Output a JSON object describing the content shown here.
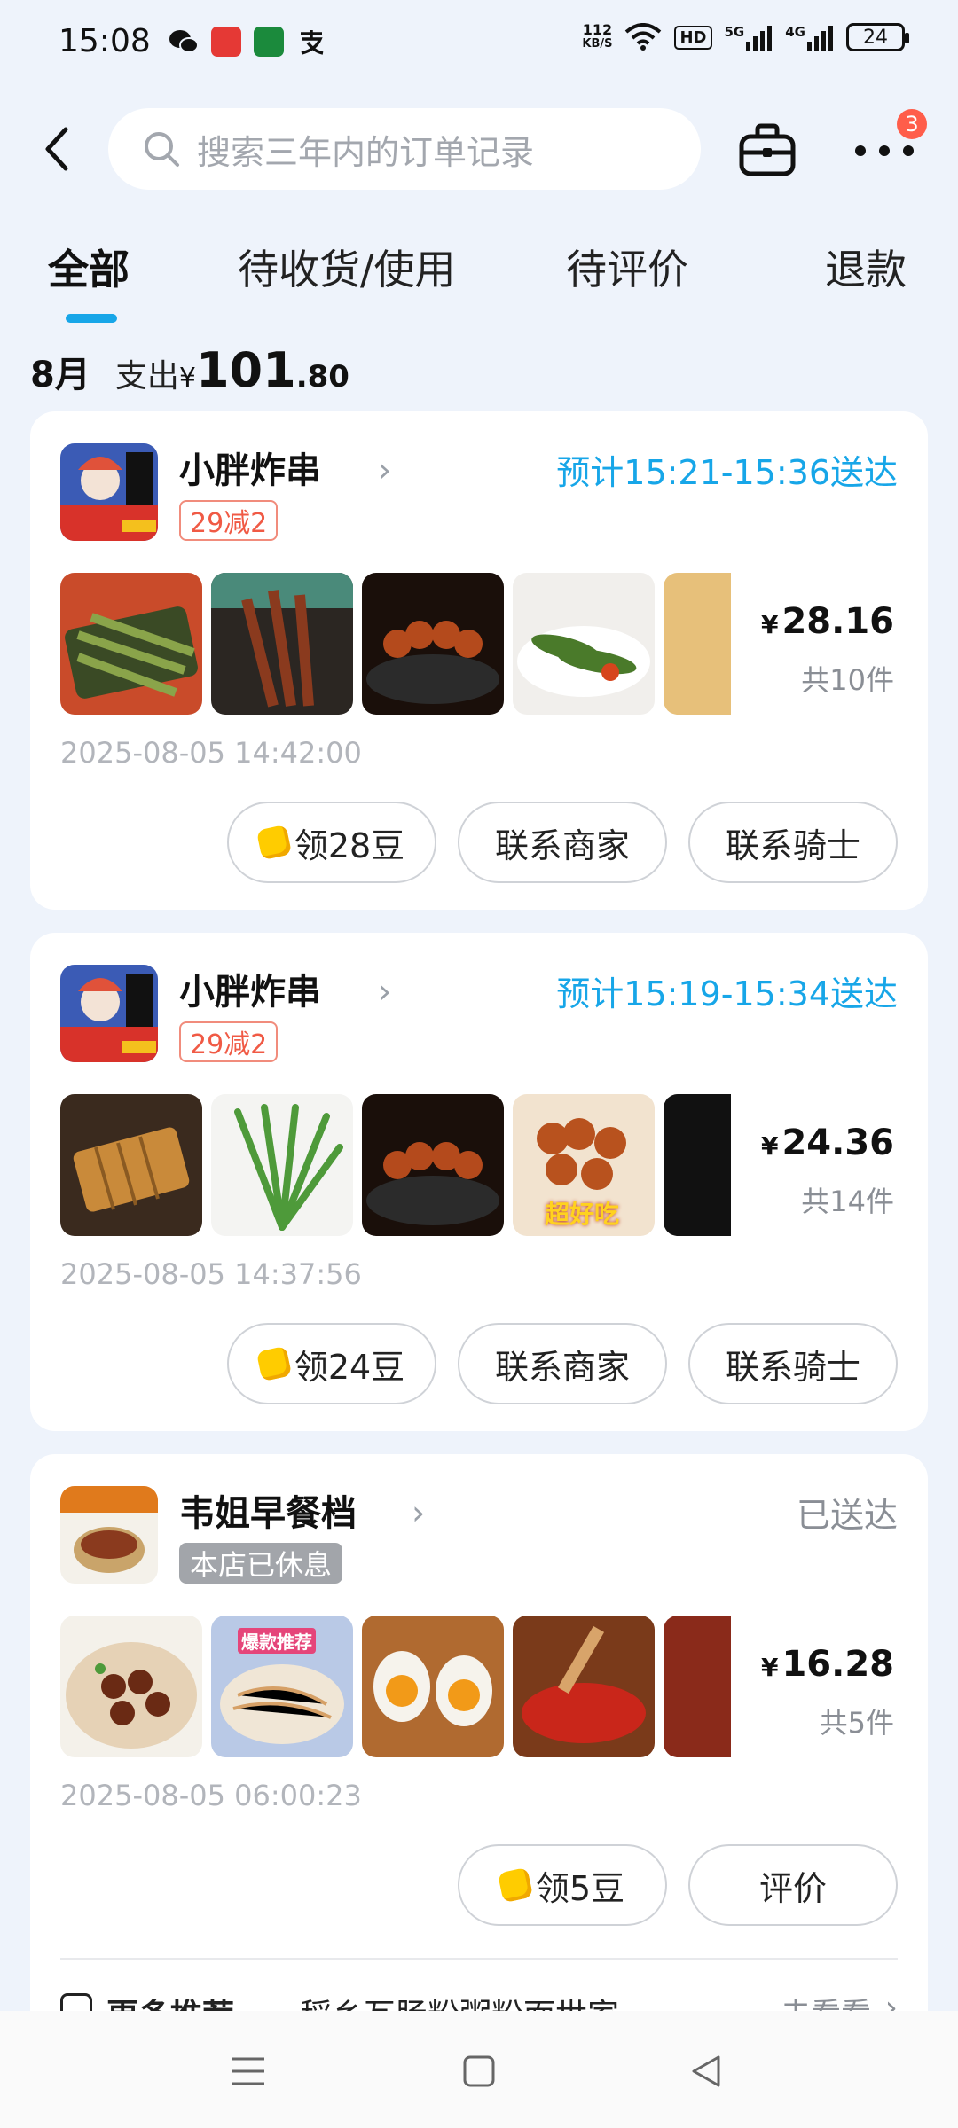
{
  "status_bar": {
    "time": "15:08",
    "net_speed_value": "112",
    "net_speed_unit": "KB/S",
    "hd_label": "HD",
    "signal1": "5G",
    "signal2": "4G",
    "battery": "24"
  },
  "header": {
    "search_placeholder": "搜索三年内的订单记录",
    "more_badge": "3"
  },
  "tabs": [
    {
      "label": "全部",
      "active": true
    },
    {
      "label": "待收货/使用",
      "active": false
    },
    {
      "label": "待评价",
      "active": false
    },
    {
      "label": "退款",
      "active": false
    }
  ],
  "summary": {
    "month": "8月",
    "label": "支出",
    "currency": "¥",
    "amount_int": "101",
    "amount_dec": ".80"
  },
  "orders": [
    {
      "shop_name": "小胖炸串",
      "tag": "29减2",
      "status": "预计15:21-15:36送达",
      "currency": "¥",
      "price": "28.16",
      "count": "共10件",
      "time": "2025-08-05 14:42:00",
      "buttons": [
        "领28豆",
        "联系商家",
        "联系骑士"
      ]
    },
    {
      "shop_name": "小胖炸串",
      "tag": "29减2",
      "status": "预计15:19-15:34送达",
      "currency": "¥",
      "price": "24.36",
      "count": "共14件",
      "time": "2025-08-05 14:37:56",
      "thumb_overlay": "超好吃",
      "buttons": [
        "领24豆",
        "联系商家",
        "联系骑士"
      ]
    },
    {
      "shop_name": "韦姐早餐档",
      "tag": "本店已休息",
      "status": "已送达",
      "currency": "¥",
      "price": "16.28",
      "count": "共5件",
      "time": "2025-08-05 06:00:23",
      "thumb_overlay": "爆款推荐",
      "buttons": [
        "领5豆",
        "评价"
      ]
    }
  ],
  "recommend": {
    "title": "更多推荐",
    "shop": "稻乡瓦肠粉粥粉面世家",
    "action": "去看看"
  },
  "colors": {
    "accent": "#17a6e8",
    "deal": "#f05a45",
    "background": "#eef3fb"
  }
}
